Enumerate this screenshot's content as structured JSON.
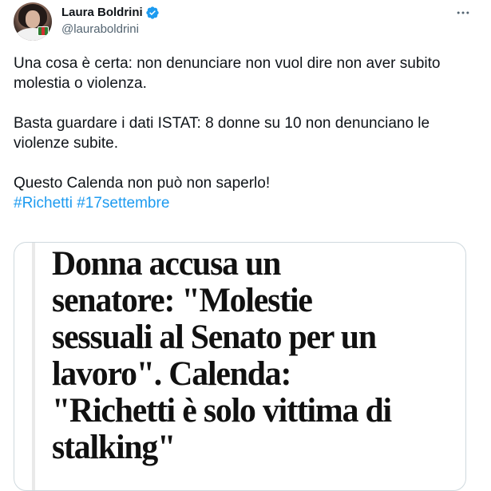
{
  "tweet": {
    "display_name": "Laura Boldrini",
    "handle": "@lauraboldrini",
    "verified_icon": "verified-badge-icon",
    "more_icon": "more-options-icon",
    "colors": {
      "text": "#0f1419",
      "secondary": "#536471",
      "link": "#1d9bf0",
      "verified": "#1d9bf0",
      "border": "#cfd9de"
    },
    "text_paragraphs": [
      "Una cosa è certa: non denunciare non vuol dire non aver subito molestia o violenza.",
      "Basta guardare i dati ISTAT: 8 donne su 10 non denunciano le violenze subite.",
      "Questo Calenda non può non saperlo!"
    ],
    "hashtags": [
      "#Richetti",
      "#17settembre"
    ]
  },
  "card": {
    "headline_lines": [
      "Donna accusa un",
      "senatore: \"Molestie",
      "sessuali al Senato per un",
      "lavoro\". Calenda:",
      "\"Richetti è solo vittima di",
      "stalking\""
    ]
  }
}
